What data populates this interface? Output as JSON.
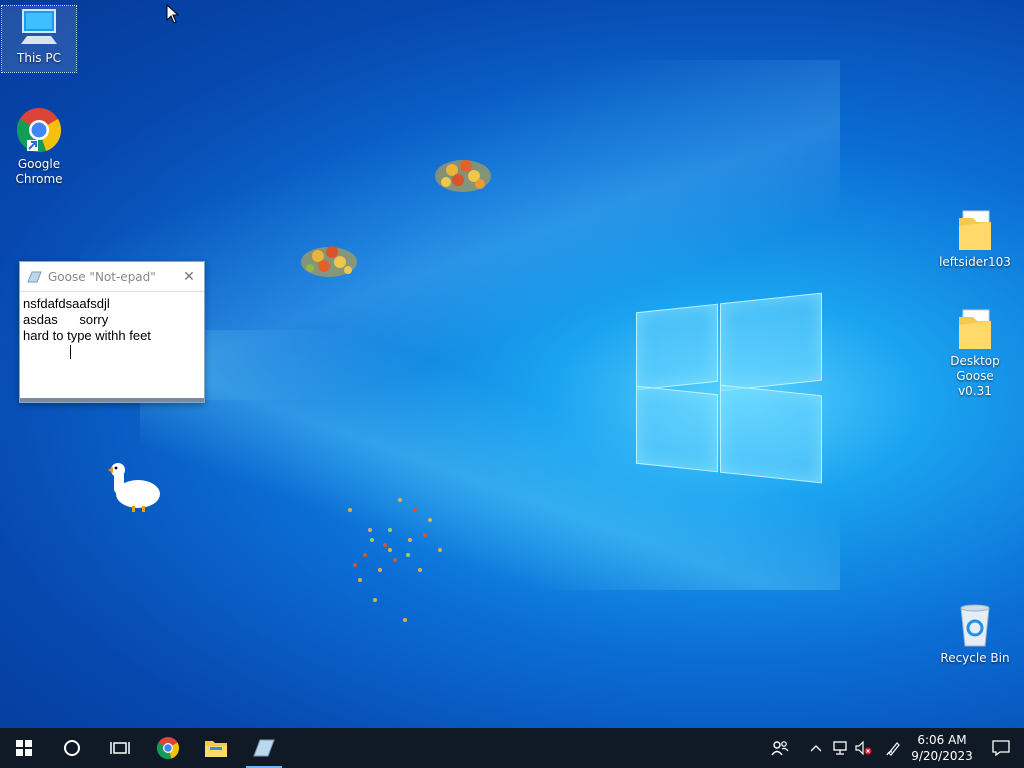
{
  "desktop": {
    "icons": [
      {
        "label": "This PC"
      },
      {
        "label": "Google Chrome"
      },
      {
        "label": "leftsider103"
      },
      {
        "label": "Desktop Goose v0.31"
      },
      {
        "label": "Recycle Bin"
      }
    ]
  },
  "notepad": {
    "title": "Goose \"Not-epad\"",
    "lines": [
      "nsfdafdsaafsdjl",
      "asdas      sorry",
      "hard to type withh feet"
    ]
  },
  "taskbar": {
    "time": "6:06 AM",
    "date": "9/20/2023"
  }
}
